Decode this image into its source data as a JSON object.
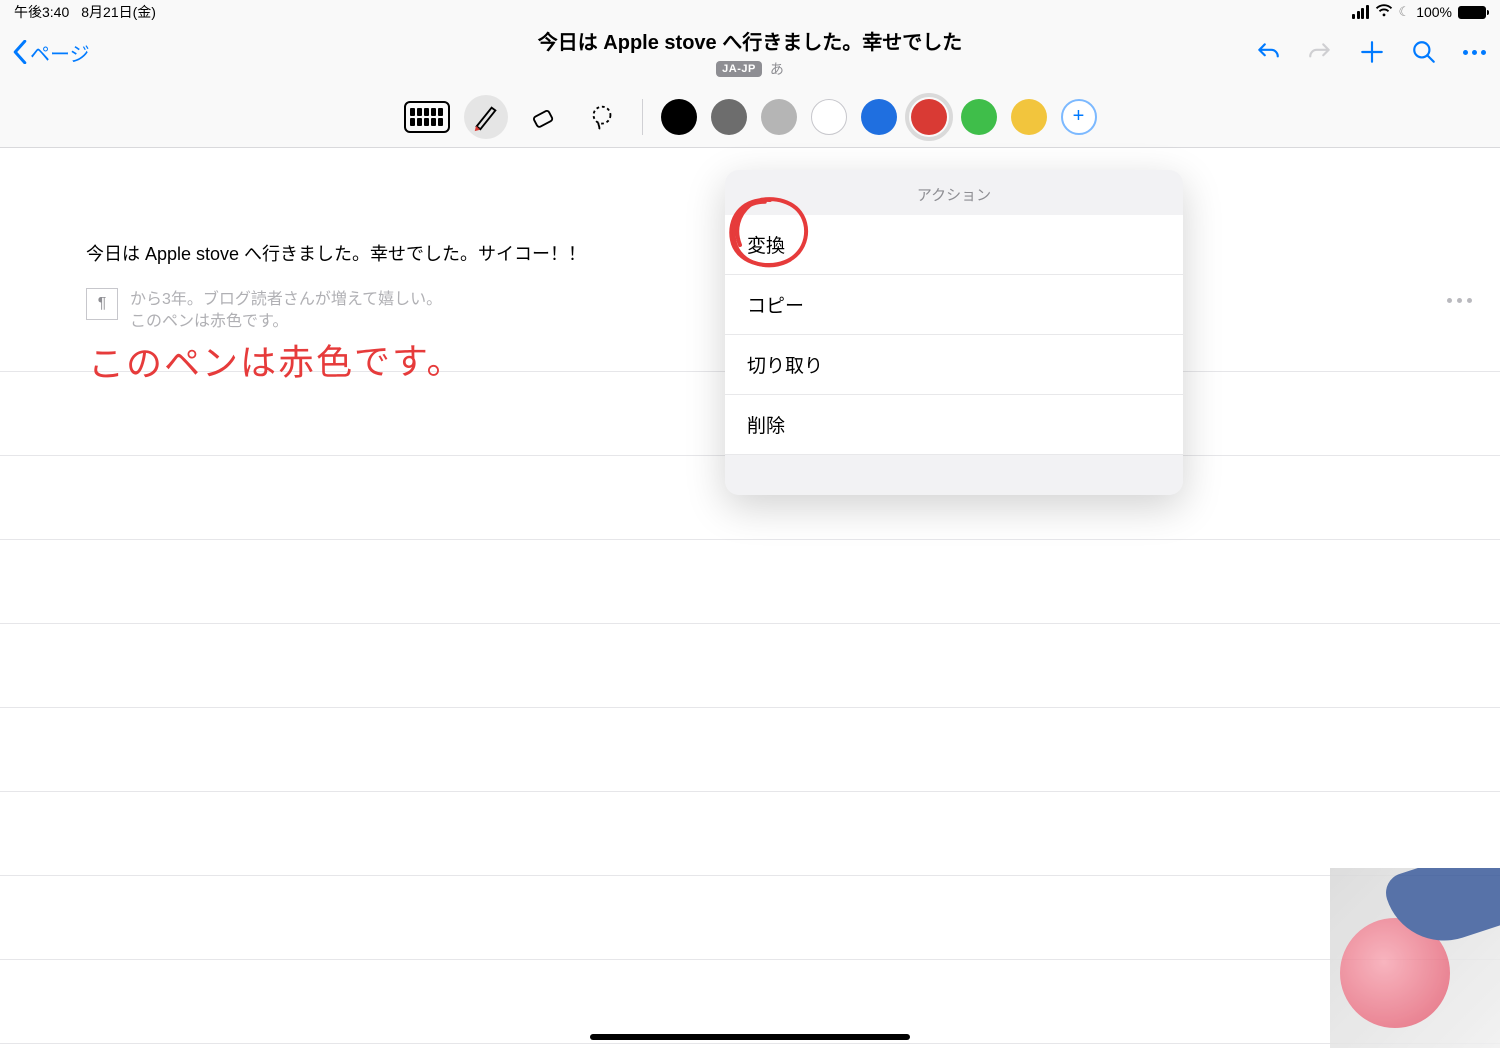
{
  "statusbar": {
    "time": "午後3:40",
    "date": "8月21日(金)",
    "battery_pct": "100%"
  },
  "nav": {
    "back_label": "ページ",
    "title": "今日は Apple stove へ行きました。幸せでした",
    "lang_badge": "JA-JP",
    "lang_hint": "あ"
  },
  "toolbar": {
    "colors": [
      {
        "name": "black",
        "hex": "#000000"
      },
      {
        "name": "dark-gray",
        "hex": "#6d6d6d"
      },
      {
        "name": "light-gray",
        "hex": "#b5b5b5"
      },
      {
        "name": "white",
        "hex": "#ffffff",
        "border": true
      },
      {
        "name": "blue",
        "hex": "#1f6fe0"
      },
      {
        "name": "red",
        "hex": "#d93a34",
        "selected": true
      },
      {
        "name": "green",
        "hex": "#3fbe4a"
      },
      {
        "name": "yellow",
        "hex": "#f2c53d"
      }
    ]
  },
  "content": {
    "typed_line": "今日は Apple stove へ行きました。幸せでした。サイコー！！",
    "grey_preview_line1": "から3年。ブログ読者さんが増えて嬉しい。",
    "grey_preview_line2": "このペンは赤色です。",
    "handwriting": "このペンは赤色です。"
  },
  "popover": {
    "header": "アクション",
    "items": [
      "変換",
      "コピー",
      "切り取り",
      "削除"
    ]
  }
}
